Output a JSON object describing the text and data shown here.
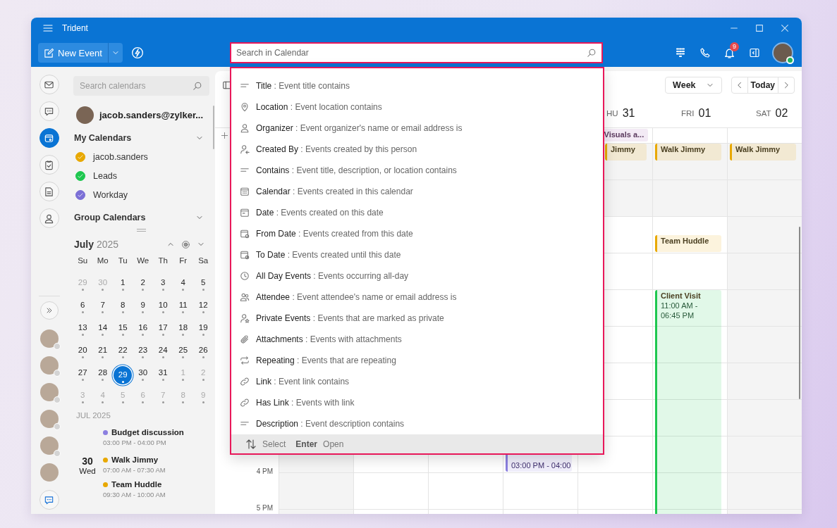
{
  "window": {
    "title": "Trident"
  },
  "toolbar": {
    "new_event": "New Event",
    "search": {
      "placeholder": "Search in Calendar"
    },
    "notification_count": "9"
  },
  "rail": {
    "items": [
      {
        "kind": "mail",
        "selected": false
      },
      {
        "kind": "chat",
        "selected": false
      },
      {
        "kind": "calendar",
        "selected": true
      },
      {
        "kind": "tasks",
        "selected": false
      },
      {
        "kind": "notes",
        "selected": false
      },
      {
        "kind": "contacts",
        "selected": false
      }
    ],
    "people": [
      {
        "status_dot": true
      },
      {
        "status_dot": true
      },
      {
        "status_dot": true
      },
      {
        "status_dot": true
      },
      {
        "status_dot": true
      },
      {
        "status_dot": false
      }
    ]
  },
  "sidebar": {
    "search": {
      "placeholder": "Search calendars"
    },
    "account": "jacob.sanders@zylker...",
    "my_calendars": {
      "title": "My Calendars",
      "items": [
        {
          "name": "jacob.sanders",
          "color": "#e8a800",
          "checked": true
        },
        {
          "name": "Leads",
          "color": "#1ec74f",
          "checked": true
        },
        {
          "name": "Workday",
          "color": "#7b6fd6",
          "checked": true
        }
      ]
    },
    "group_calendars": {
      "title": "Group Calendars"
    },
    "mini_calendar": {
      "month": "July",
      "year": "2025",
      "weekdays": [
        "Su",
        "Mo",
        "Tu",
        "We",
        "Th",
        "Fr",
        "Sa"
      ],
      "weeks": [
        [
          {
            "day": "29",
            "outside": true,
            "selected": false
          },
          {
            "day": "30",
            "outside": true,
            "selected": false
          },
          {
            "day": "1",
            "outside": false,
            "selected": false
          },
          {
            "day": "2",
            "outside": false,
            "selected": false
          },
          {
            "day": "3",
            "outside": false,
            "selected": false
          },
          {
            "day": "4",
            "outside": false,
            "selected": false
          },
          {
            "day": "5",
            "outside": false,
            "selected": false
          }
        ],
        [
          {
            "day": "6",
            "outside": false,
            "selected": false
          },
          {
            "day": "7",
            "outside": false,
            "selected": false
          },
          {
            "day": "8",
            "outside": false,
            "selected": false
          },
          {
            "day": "9",
            "outside": false,
            "selected": false
          },
          {
            "day": "10",
            "outside": false,
            "selected": false
          },
          {
            "day": "11",
            "outside": false,
            "selected": false
          },
          {
            "day": "12",
            "outside": false,
            "selected": false
          }
        ],
        [
          {
            "day": "13",
            "outside": false,
            "selected": false
          },
          {
            "day": "14",
            "outside": false,
            "selected": false
          },
          {
            "day": "15",
            "outside": false,
            "selected": false
          },
          {
            "day": "16",
            "outside": false,
            "selected": false
          },
          {
            "day": "17",
            "outside": false,
            "selected": false
          },
          {
            "day": "18",
            "outside": false,
            "selected": false
          },
          {
            "day": "19",
            "outside": false,
            "selected": false
          }
        ],
        [
          {
            "day": "20",
            "outside": false,
            "selected": false
          },
          {
            "day": "21",
            "outside": false,
            "selected": false
          },
          {
            "day": "22",
            "outside": false,
            "selected": false
          },
          {
            "day": "23",
            "outside": false,
            "selected": false
          },
          {
            "day": "24",
            "outside": false,
            "selected": false
          },
          {
            "day": "25",
            "outside": false,
            "selected": false
          },
          {
            "day": "26",
            "outside": false,
            "selected": false
          }
        ],
        [
          {
            "day": "27",
            "outside": false,
            "selected": false
          },
          {
            "day": "28",
            "outside": false,
            "selected": false
          },
          {
            "day": "29",
            "outside": false,
            "selected": true
          },
          {
            "day": "30",
            "outside": false,
            "selected": false
          },
          {
            "day": "31",
            "outside": false,
            "selected": false
          },
          {
            "day": "1",
            "outside": true,
            "selected": false
          },
          {
            "day": "2",
            "outside": true,
            "selected": false
          }
        ],
        [
          {
            "day": "3",
            "outside": true,
            "selected": false
          },
          {
            "day": "4",
            "outside": true,
            "selected": false
          },
          {
            "day": "5",
            "outside": true,
            "selected": false
          },
          {
            "day": "6",
            "outside": true,
            "selected": false
          },
          {
            "day": "7",
            "outside": true,
            "selected": false
          },
          {
            "day": "8",
            "outside": true,
            "selected": false
          },
          {
            "day": "9",
            "outside": true,
            "selected": false
          }
        ]
      ]
    },
    "agenda": {
      "heading": "JUL 2025",
      "groups": [
        {
          "events": [
            {
              "title": "Budget discussion",
              "time": "03:00 PM - 04:00 PM",
              "color": "#8b7fe0"
            }
          ]
        },
        {
          "date": "30",
          "weekday": "Wed",
          "events": [
            {
              "title": "Walk Jimmy",
              "time": "07:00 AM - 07:30 AM",
              "color": "#e8a800"
            },
            {
              "title": "Team Huddle",
              "time": "09:30 AM - 10:00 AM",
              "color": "#e8a800"
            }
          ]
        }
      ]
    }
  },
  "calendar": {
    "view": "Week",
    "today": "Today",
    "time_labels": [
      "4 PM",
      "5 PM"
    ],
    "columns": [
      {
        "kind": "weekend"
      },
      {
        "kind": "workday"
      },
      {
        "kind": "workday"
      },
      {
        "kind": "workday",
        "events": [
          {
            "time": "03:00 PM - 04:00",
            "color": "#8b7fe0"
          }
        ]
      },
      {
        "kind": "workday",
        "day": "HU",
        "date": "31",
        "all_day": [
          {
            "title": "Visuals a...",
            "color": "#f3eaf5"
          }
        ],
        "events": [
          {
            "title": "Jimmy",
            "color": "#e8a800"
          }
        ]
      },
      {
        "kind": "workday",
        "day": "FRI",
        "date": "01",
        "events": [
          {
            "title": "Walk Jimmy",
            "color": "#e8a800"
          },
          {
            "title": "Team Huddle",
            "color": "#e8a800"
          },
          {
            "title": "Client Visit",
            "time": "11:00 AM - 06:45 PM",
            "color": "#1ec74f"
          }
        ]
      },
      {
        "kind": "weekend",
        "day": "SAT",
        "date": "02",
        "events": [
          {
            "title": "Walk Jimmy",
            "color": "#e8a800"
          }
        ]
      }
    ]
  },
  "search_menu": {
    "items": [
      {
        "kind": "lines",
        "text": "**Title** : Event title contains"
      },
      {
        "kind": "pin",
        "text": "**Location** : Event location contains"
      },
      {
        "kind": "person",
        "text": "**Organizer** : Event organizer's name or email address is"
      },
      {
        "kind": "person-add",
        "text": "**Created By** : Events created by this person"
      },
      {
        "kind": "lines",
        "text": "**Contains** : Event title, description, or location contains"
      },
      {
        "kind": "calendar",
        "text": "**Calendar** : Events created in this calendar"
      },
      {
        "kind": "date",
        "text": "**Date** : Events created on this date"
      },
      {
        "kind": "date-from",
        "text": "**From Date** : Events created from this date"
      },
      {
        "kind": "date-to",
        "text": "**To Date** : Events created until this date"
      },
      {
        "kind": "clock",
        "text": "**All Day Events** : Events occurring all-day"
      },
      {
        "kind": "people",
        "text": "**Attendee** : Event attendee's name or email address is"
      },
      {
        "kind": "person-star",
        "text": "**Private Events** : Events that are marked as private"
      },
      {
        "kind": "clip",
        "text": "**Attachments** : Events with attachments"
      },
      {
        "kind": "repeat",
        "text": "**Repeating** : Events that are repeating"
      },
      {
        "kind": "link",
        "text": "**Link** : Event link contains"
      },
      {
        "kind": "link",
        "text": "**Has Link** : Events with link"
      },
      {
        "kind": "lines",
        "text": "**Description** : Event description contains"
      }
    ],
    "footer": {
      "select": "Select",
      "key": "Enter",
      "open": "Open"
    }
  }
}
